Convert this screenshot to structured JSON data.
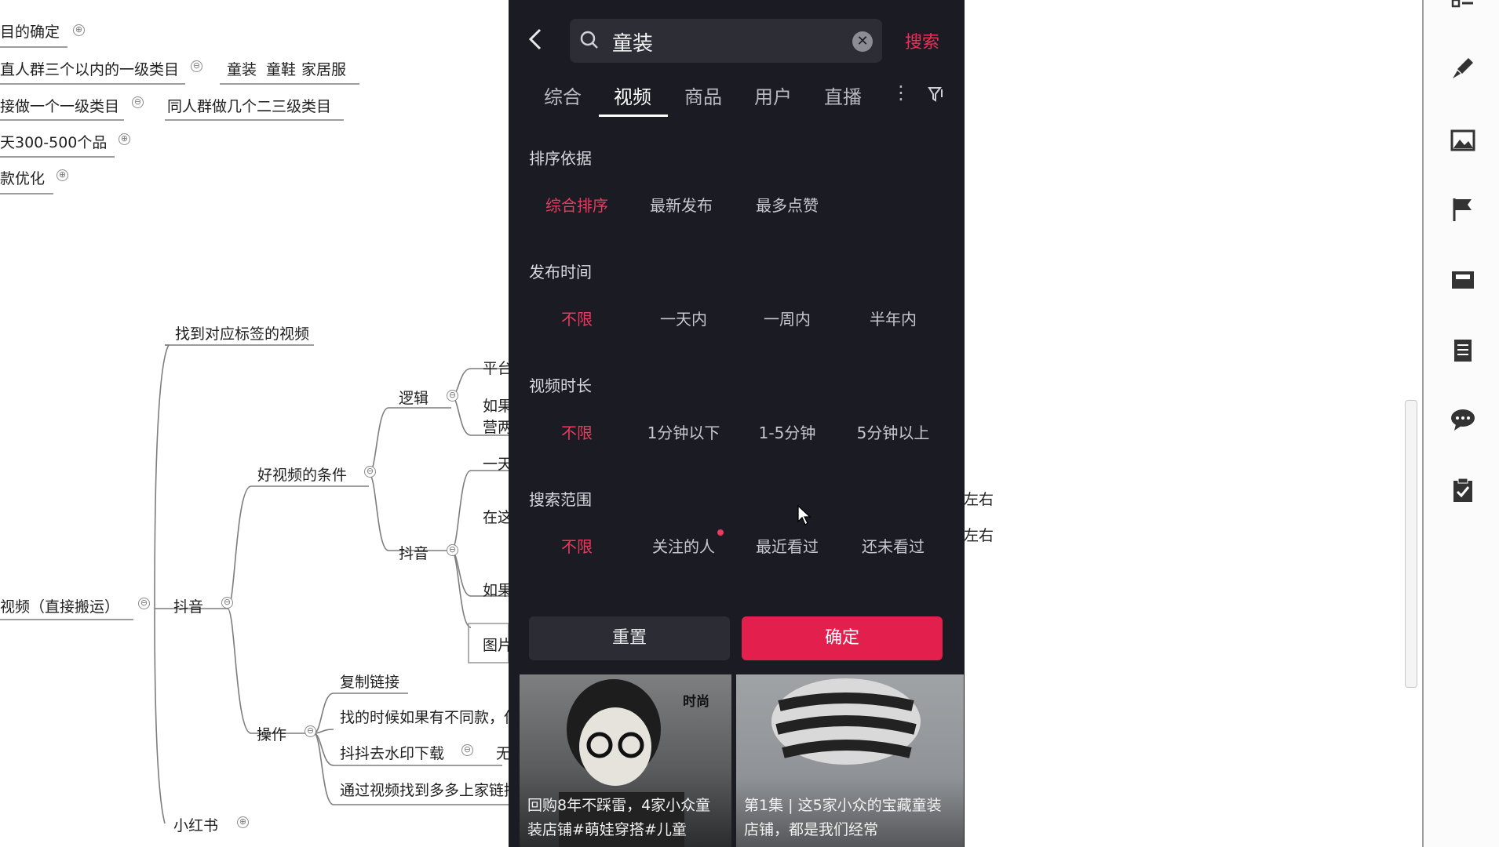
{
  "mindmap": {
    "top_items": [
      {
        "label": "目的确定",
        "toggle": "⊕"
      },
      {
        "label": "直人群三个以内的一级类目",
        "toggle": "⊖",
        "children": [
          "童装",
          "童鞋",
          "家居服"
        ]
      },
      {
        "label": "接做一个一级类目",
        "toggle": "⊖",
        "child": "同人群做几个二三级类目"
      },
      {
        "label": "天300-500个品",
        "toggle": "⊕"
      },
      {
        "label": "款优化",
        "toggle": "⊕"
      }
    ],
    "nodes": {
      "find_tag_video": "找到对应标签的视频",
      "logic": "逻辑",
      "good_video_conditions": "好视频的条件",
      "douyin_sub": "抖音",
      "video_direct": "视频（直接搬运）",
      "douyin": "抖音",
      "operation": "操作",
      "copy_link": "复制链接",
      "find_diff": "找的时候如果有不同款，但",
      "douyin_watermark": "抖抖去水印下载",
      "find_pdd": "通过视频找到多多上家链接",
      "xiaohongshu": "小红书",
      "partial_1": "平台",
      "partial_2": "如果",
      "partial_3": "营两",
      "partial_4": "一天",
      "partial_5": "在这",
      "partial_6": "如果",
      "partial_7": "图片",
      "partial_8": "无",
      "right_1": "左右",
      "right_2": "左右"
    }
  },
  "phone": {
    "search": {
      "value": "童装",
      "button": "搜索"
    },
    "tabs": [
      "综合",
      "视频",
      "商品",
      "用户",
      "直播"
    ],
    "active_tab": "视频",
    "sections": [
      {
        "title": "排序依据",
        "options": [
          "综合排序",
          "最新发布",
          "最多点赞"
        ],
        "active": "综合排序"
      },
      {
        "title": "发布时间",
        "options": [
          "不限",
          "一天内",
          "一周内",
          "半年内"
        ],
        "active": "不限"
      },
      {
        "title": "视频时长",
        "options": [
          "不限",
          "1分钟以下",
          "1-5分钟",
          "5分钟以上"
        ],
        "active": "不限"
      },
      {
        "title": "搜索范围",
        "options": [
          "不限",
          "关注的人",
          "最近看过",
          "还未看过"
        ],
        "active": "不限"
      }
    ],
    "buttons": {
      "reset": "重置",
      "confirm": "确定"
    },
    "videos": [
      {
        "tag": "时尚",
        "caption": "回购8年不踩雷，4家小众童装店铺#萌娃穿搭#儿童"
      },
      {
        "caption": "第1集 | 这5家小众的宝藏童装店铺，都是我们经常"
      }
    ]
  },
  "colors": {
    "accent": "#e31f4e",
    "phone_bg": "#1b1b23"
  },
  "toolbar_icons": [
    "list-icon",
    "brush-icon",
    "image-icon",
    "flag-icon",
    "card-icon",
    "document-icon",
    "chat-icon",
    "clipboard-icon"
  ]
}
